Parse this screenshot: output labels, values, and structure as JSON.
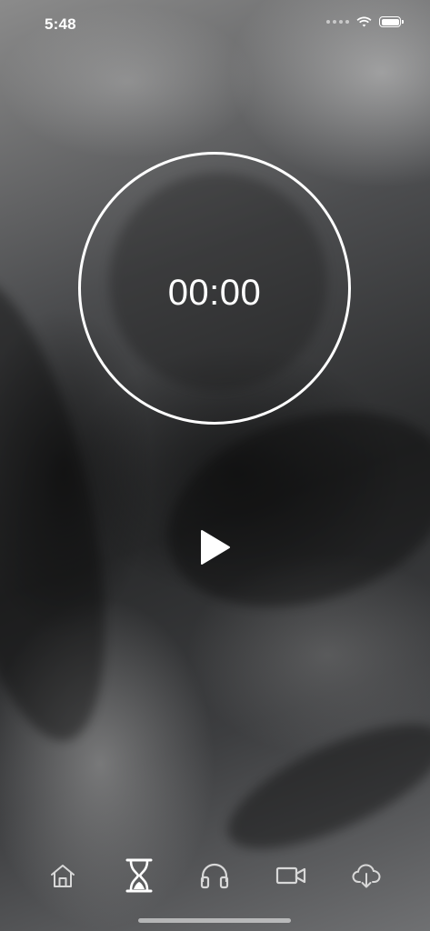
{
  "status_bar": {
    "time": "5:48",
    "icons": [
      "cellular-signal-icon",
      "wifi-icon",
      "battery-icon"
    ]
  },
  "timer": {
    "display": "00:00"
  },
  "controls": {
    "play_icon": "play-icon"
  },
  "tab_bar": {
    "tabs": [
      {
        "icon": "home-icon",
        "selected": false
      },
      {
        "icon": "hourglass-icon",
        "selected": true
      },
      {
        "icon": "headphones-icon",
        "selected": false
      },
      {
        "icon": "video-camera-icon",
        "selected": false
      },
      {
        "icon": "cloud-download-icon",
        "selected": false
      }
    ]
  },
  "colors": {
    "foreground": "#ffffff",
    "inactive_tab": "#d8d8d8"
  }
}
